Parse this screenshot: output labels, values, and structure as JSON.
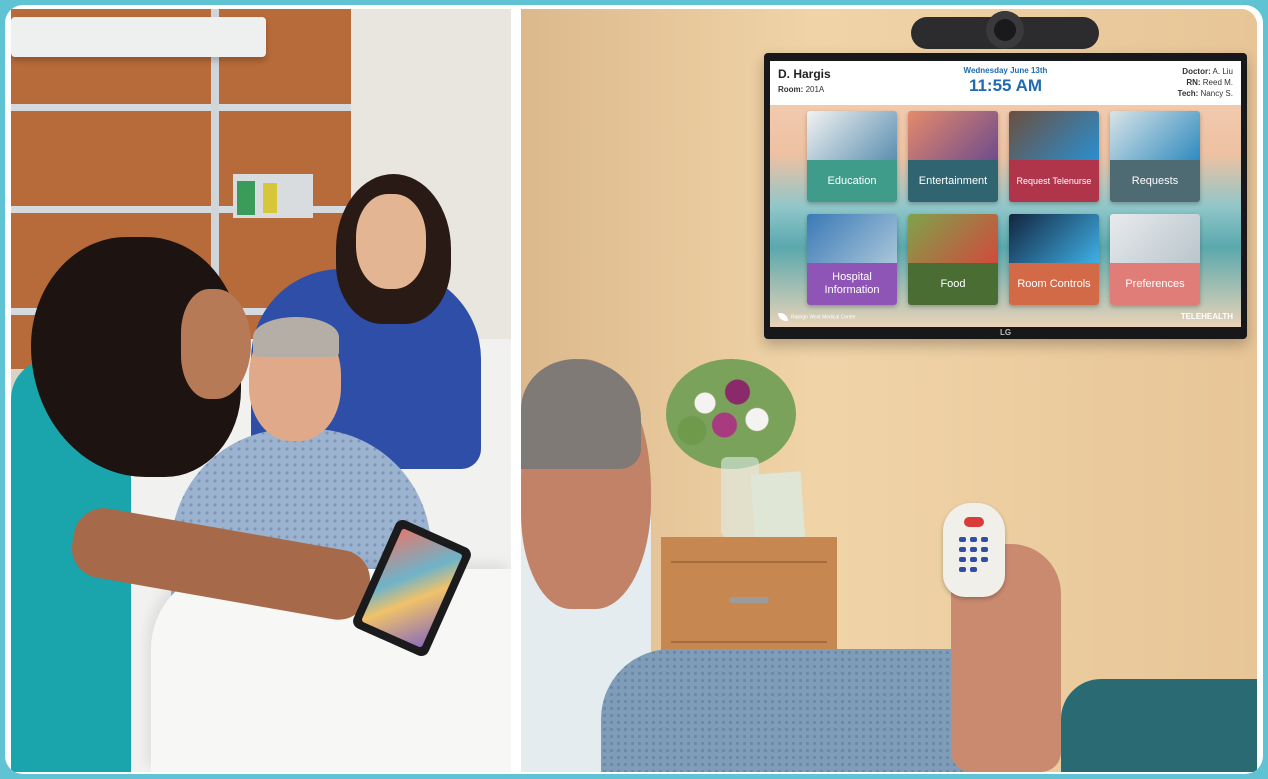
{
  "tv_screen": {
    "patient_name": "D. Hargis",
    "room_label": "Room:",
    "room_value": "201A",
    "date": "Wednesday June 13th",
    "time": "11:55 AM",
    "doctor_label": "Doctor:",
    "doctor_value": "A. Liu",
    "rn_label": "RN:",
    "rn_value": "Reed M.",
    "tech_label": "Tech:",
    "tech_value": "Nancy S.",
    "tiles": [
      {
        "label": "Education",
        "color": "#3f9c8b",
        "image_colors": [
          "#f2f2f2",
          "#5b8fb0"
        ]
      },
      {
        "label": "Entertainment",
        "color": "#2f6470",
        "image_colors": [
          "#e68a6b",
          "#6d4c8d"
        ]
      },
      {
        "label": "Request Telenurse",
        "color": "#b0354b",
        "image_colors": [
          "#6b4f3f",
          "#2a8fd0"
        ]
      },
      {
        "label": "Requests",
        "color": "#4e6a72",
        "image_colors": [
          "#d9e4e6",
          "#2f8ac0"
        ]
      },
      {
        "label": "Hospital Information",
        "color": "#8e55b6",
        "image_colors": [
          "#3a79b6",
          "#a9c6da"
        ]
      },
      {
        "label": "Food",
        "color": "#4a6d34",
        "image_colors": [
          "#7ea34b",
          "#d14a3b"
        ]
      },
      {
        "label": "Room Controls",
        "color": "#d26a48",
        "image_colors": [
          "#12253f",
          "#3fb0e6"
        ]
      },
      {
        "label": "Preferences",
        "color": "#e07d78",
        "image_colors": [
          "#e8ebed",
          "#b9c5cc"
        ]
      }
    ],
    "footer_left": "Raleigh West Medical Center",
    "footer_right": "TELEHEALTH"
  },
  "tv_brand": "LG",
  "colors": {
    "border": "#5fc3d3",
    "header_accent": "#1f6ab0"
  }
}
